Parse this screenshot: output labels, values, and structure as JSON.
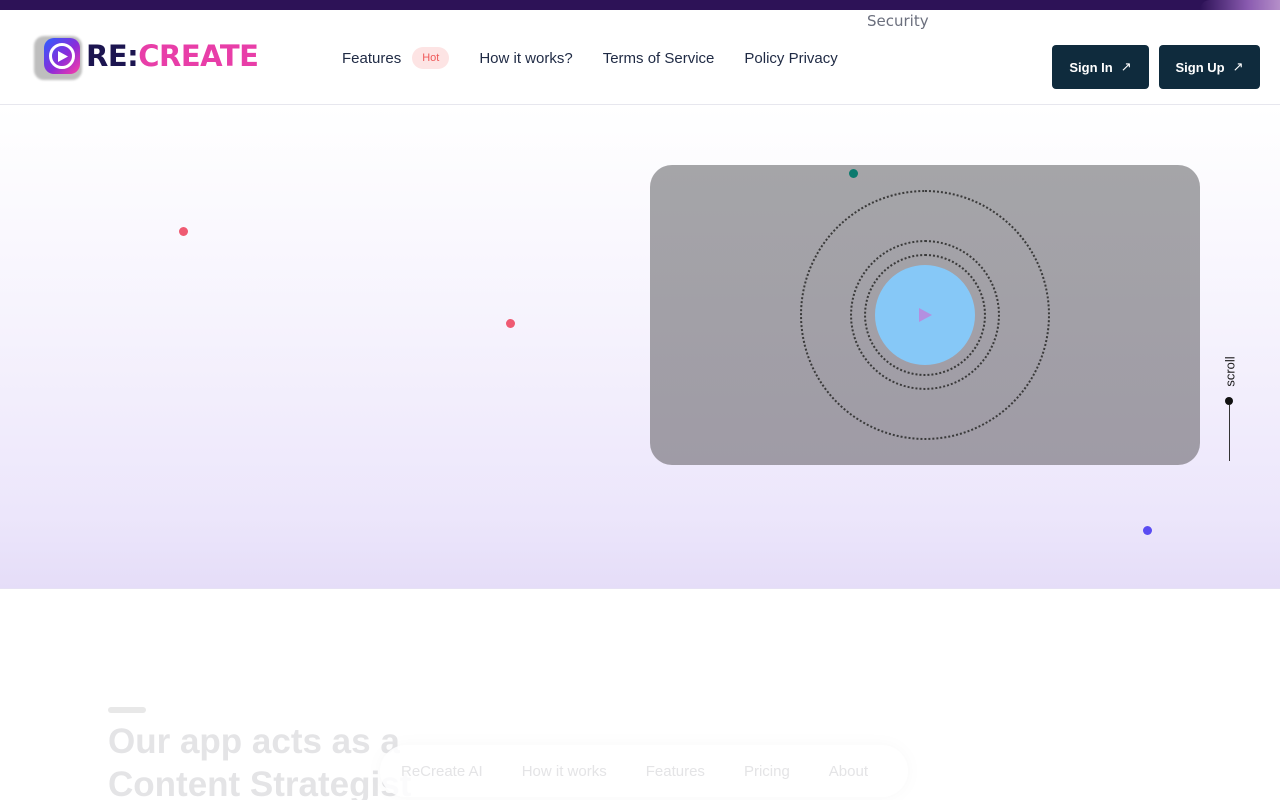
{
  "brand": {
    "name_part1": "RE:",
    "name_part2": "CREATE",
    "colors": {
      "primary": "#1c1550",
      "accent": "#e83ea8",
      "button": "#0f2b3d"
    }
  },
  "top_link": "Security",
  "nav": {
    "features": "Features",
    "features_badge": "Hot",
    "how_it_works": "How it works?",
    "terms": "Terms of Service",
    "privacy": "Policy Privacy"
  },
  "buttons": {
    "sign_in": "Sign In",
    "sign_up": "Sign Up",
    "arrow": "↗"
  },
  "hero": {
    "video_play_icon": "play-icon",
    "scroll_label": "scroll"
  },
  "section": {
    "title_line1": "Our app acts as a",
    "title_line2": "Content Strategist"
  },
  "floating_nav": [
    "ReCreate AI",
    "How it works",
    "Features",
    "Pricing",
    "About"
  ]
}
